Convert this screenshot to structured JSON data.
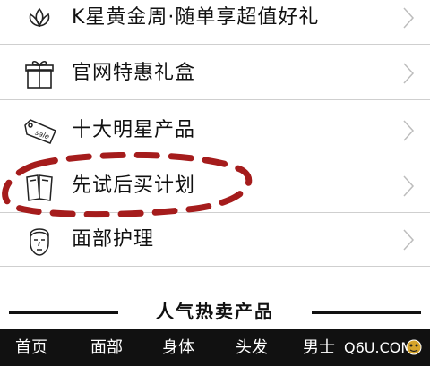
{
  "menu": {
    "items": [
      {
        "label": "K星黄金周·随单享超值好礼",
        "icon": "lotus-icon"
      },
      {
        "label": "官网特惠礼盒",
        "icon": "gift-box-icon"
      },
      {
        "label": "十大明星产品",
        "icon": "sale-tag-icon"
      },
      {
        "label": "先试后买计划",
        "icon": "sample-cards-icon"
      },
      {
        "label": "面部护理",
        "icon": "face-icon"
      }
    ]
  },
  "section": {
    "title": "人气热卖产品"
  },
  "bottom_nav": {
    "tabs": [
      "首页",
      "面部",
      "身体",
      "头发",
      "男士"
    ]
  },
  "watermark": {
    "text": "Q6U.COM"
  },
  "colors": {
    "highlight": "#a51c1c",
    "nav_bg": "#111111",
    "divider": "#cfcfcf"
  }
}
